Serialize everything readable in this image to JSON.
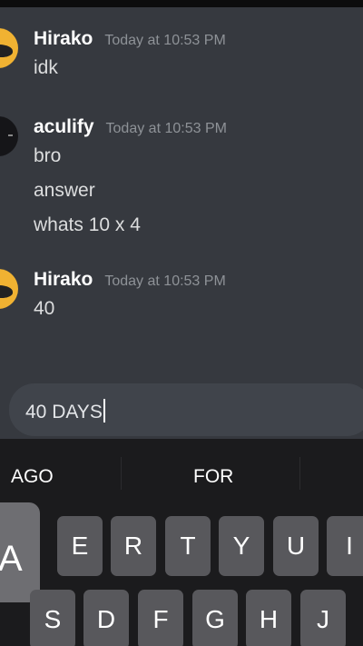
{
  "messages": [
    {
      "username": "Hirako",
      "timestamp": "Today at 10:53 PM",
      "lines": [
        "idk"
      ]
    },
    {
      "username": "aculify",
      "timestamp": "Today at 10:53 PM",
      "lines": [
        "bro",
        "answer",
        "whats 10 x 4"
      ]
    },
    {
      "username": "Hirako",
      "timestamp": "Today at 10:53 PM",
      "lines": [
        "40"
      ]
    }
  ],
  "composer": {
    "value": "40 DAYS"
  },
  "keyboard": {
    "suggestions": [
      "AGO",
      "FOR"
    ],
    "popup_key": "A",
    "row1": [
      "E",
      "R",
      "T",
      "Y",
      "U",
      "I"
    ],
    "row2": [
      "S",
      "D",
      "F",
      "G",
      "H",
      "J"
    ]
  }
}
